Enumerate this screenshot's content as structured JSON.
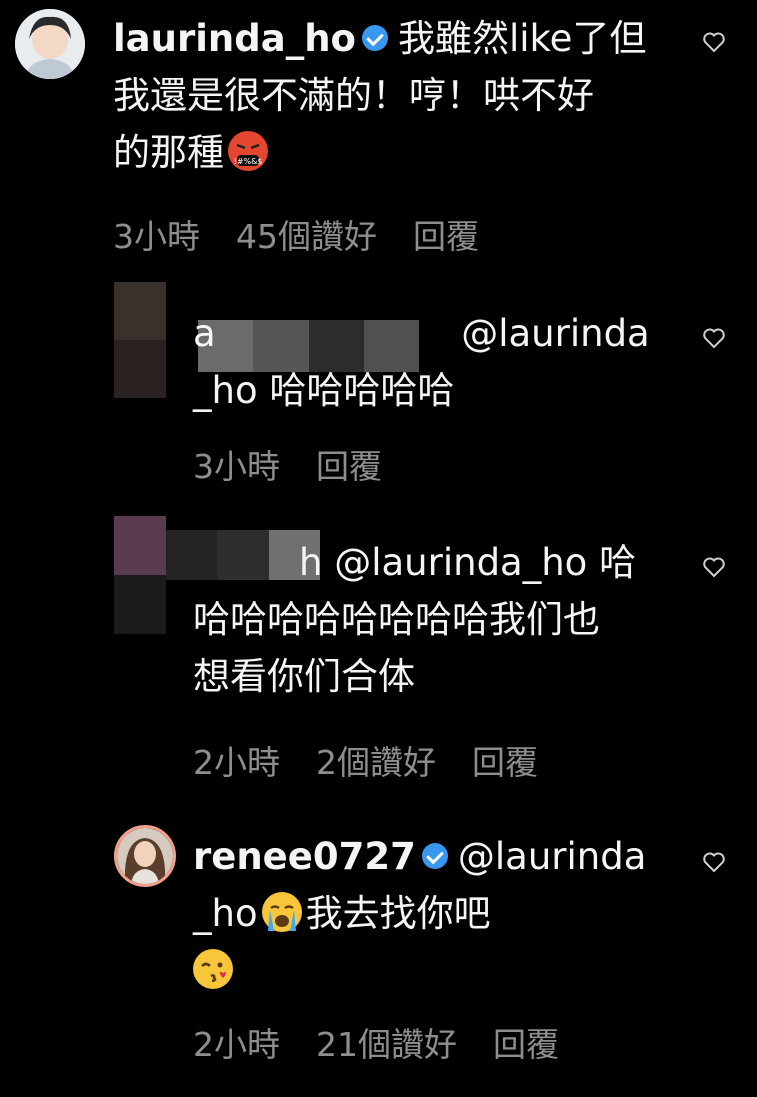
{
  "comments": [
    {
      "username": "laurinda_ho",
      "verified": true,
      "text_line1": "我雖然like了但",
      "text_line2": "我還是很不滿的！哼！哄不好",
      "text_line3": "的那種",
      "emoji": "cursing-face",
      "time": "3小時",
      "likes": "45個讚好",
      "reply": "回覆"
    },
    {
      "username_visible": "a",
      "mention": "@laurinda",
      "text_line2": "_ho 哈哈哈哈哈",
      "time": "3小時",
      "reply": "回覆"
    },
    {
      "username_visible": "h",
      "mention": "@laurinda_ho 哈",
      "text_line2": "哈哈哈哈哈哈哈哈我们也",
      "text_line3": "想看你们合体",
      "time": "2小時",
      "likes": "2個讚好",
      "reply": "回覆"
    },
    {
      "username": "renee0727",
      "verified": true,
      "mention": "@laurinda",
      "text_line2_prefix": "_ho",
      "emoji_1": "loudly-crying-face",
      "text_line2_suffix": "我去找你吧",
      "emoji_2": "face-blowing-kiss",
      "time": "2小時",
      "likes": "21個讚好",
      "reply": "回覆"
    }
  ],
  "colors": {
    "background": "#000000",
    "text": "#f5f5f5",
    "meta": "#8e8e8e",
    "verified": "#3897f0",
    "story_ring": "#f2a08a"
  }
}
